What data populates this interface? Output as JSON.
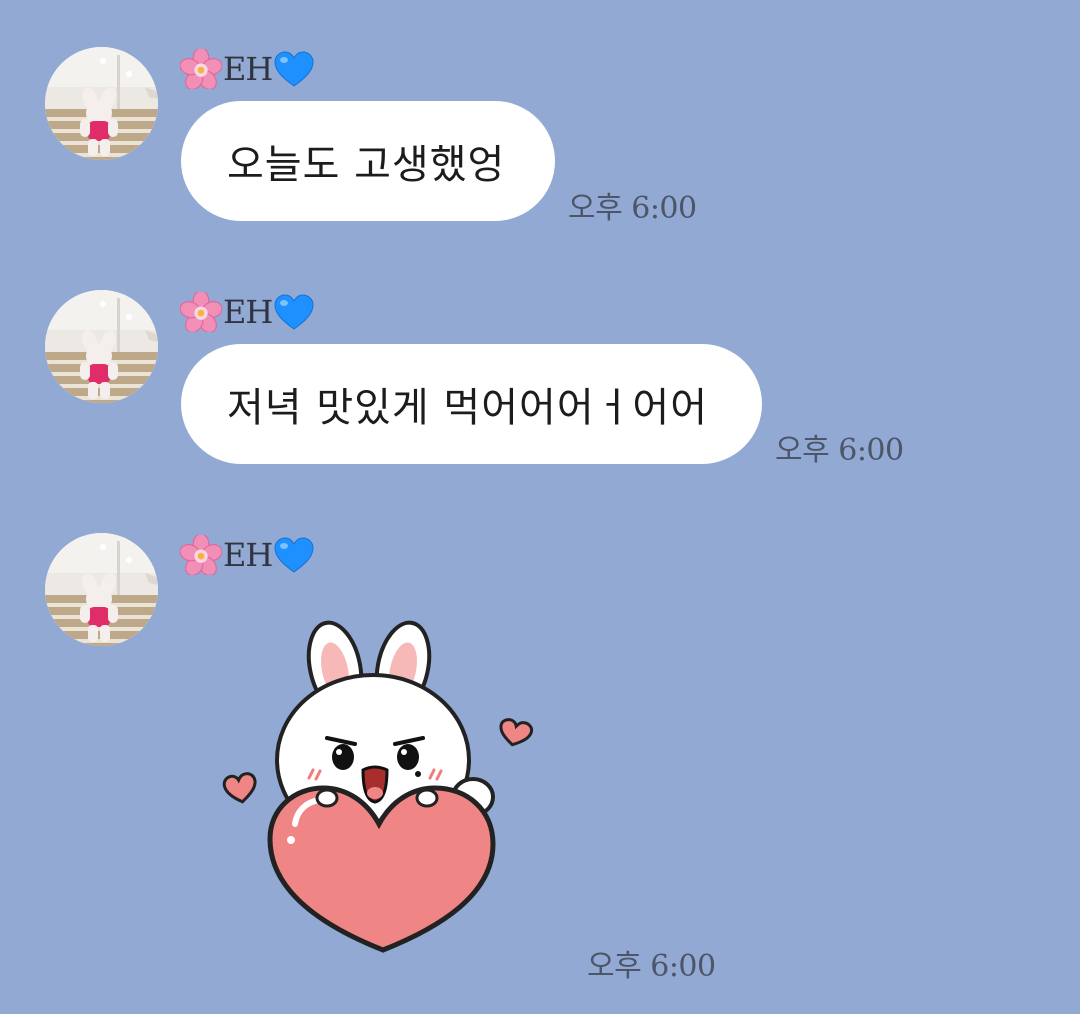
{
  "messages": [
    {
      "sender": "EH",
      "text": "오늘도 고생했엉",
      "time": "오후 6:00"
    },
    {
      "sender": "EH",
      "text": "저녁 맛있게 먹어어어ㅓ어어",
      "time": "오후 6:00"
    },
    {
      "sender": "EH",
      "sticker": "bunny-holding-heart-sticker",
      "time": "오후 6:00"
    }
  ],
  "colors": {
    "background": "#92a9d4",
    "bubble": "#ffffff",
    "sender_name": "#30343f",
    "timestamp": "#4d5568",
    "heart": "#f08585"
  },
  "icons": {
    "name_prefix": "cherry-blossom-emoji",
    "name_suffix": "blue-heart-emoji"
  }
}
